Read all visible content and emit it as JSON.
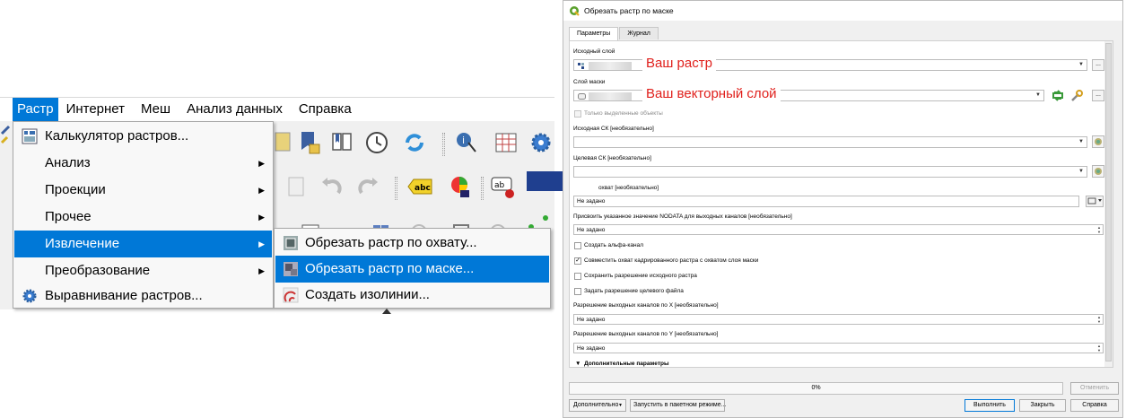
{
  "menubar": {
    "items": [
      "Растр",
      "Интернет",
      "Меш",
      "Анализ данных",
      "Справка"
    ]
  },
  "raster_menu": {
    "items": [
      {
        "label": "Калькулятор растров...",
        "has_submenu": false
      },
      {
        "label": "Анализ",
        "has_submenu": true
      },
      {
        "label": "Проекции",
        "has_submenu": true
      },
      {
        "label": "Прочее",
        "has_submenu": true
      },
      {
        "label": "Извлечение",
        "has_submenu": true
      },
      {
        "label": "Преобразование",
        "has_submenu": true
      },
      {
        "label": "Выравнивание растров...",
        "has_submenu": false
      }
    ]
  },
  "extract_submenu": {
    "items": [
      "Обрезать растр по охвату...",
      "Обрезать растр по маске...",
      "Создать изолинии..."
    ]
  },
  "dialog": {
    "title": "Обрезать растр по маске",
    "tabs": [
      "Параметры",
      "Журнал"
    ],
    "input_layer_label": "Исходный слой",
    "mask_layer_label": "Слой маски",
    "selected_only_label": "Только выделенные объекты",
    "source_crs_label": "Исходная СК [необязательно]",
    "target_crs_label": "Целевая СК [необязательно]",
    "extent_label": "охват [необязательно]",
    "extent_value": "Не задано",
    "nodata_label": "Присвоить указанное значение NODATA для выходных каналов [необязательно]",
    "nodata_value": "Не задано",
    "checkboxes": [
      {
        "label": "Создать альфа-канал",
        "checked": false
      },
      {
        "label": "Совместить охват кадрированного растра с охватом слоя маски",
        "checked": true
      },
      {
        "label": "Сохранить разрешение исходного растра",
        "checked": false
      },
      {
        "label": "Задать разрешение целевого файла",
        "checked": false
      }
    ],
    "xres_label": "Разрешение выходных каналов по X [необязательно]",
    "xres_value": "Не задано",
    "yres_label": "Разрешение выходных каналов по Y [необязательно]",
    "yres_value": "Не задано",
    "advanced_label": "Дополнительные параметры",
    "progress": "0%",
    "buttons": {
      "cancel": "Отменить",
      "advanced": "Дополнительно",
      "batch": "Запустить в пакетном режиме...",
      "run": "Выполнить",
      "close": "Закрыть",
      "help": "Справка"
    },
    "more_btn": "..."
  },
  "annotations": {
    "raster_note": "Ваш растр",
    "vector_note": "Ваш  векторный слой"
  },
  "colors": {
    "highlight": "#0078d7",
    "arrow": "#1f3f8f",
    "note_text": "#e0201c"
  }
}
